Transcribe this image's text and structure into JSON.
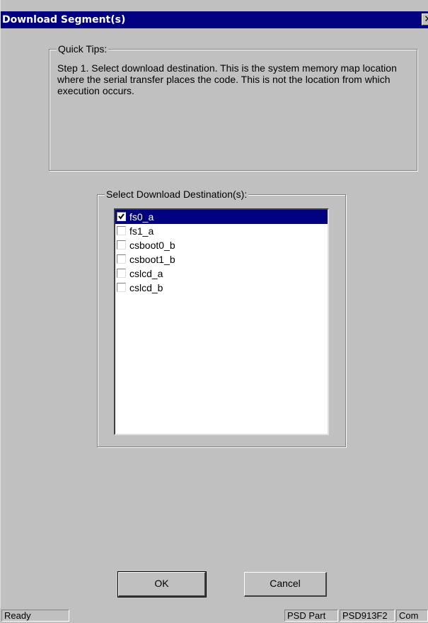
{
  "window": {
    "title": "Download Segment(s)",
    "close_glyph": "✕"
  },
  "tips": {
    "legend": "Quick Tips:",
    "text": "Step 1.  Select download destination.  This is the system memory map location where the serial transfer places the code.  This is not the location from which execution occurs."
  },
  "destinations": {
    "legend": "Select Download Destination(s):",
    "items": [
      {
        "label": "fs0_a",
        "checked": true,
        "selected": true
      },
      {
        "label": "fs1_a",
        "checked": false,
        "selected": false
      },
      {
        "label": "csboot0_b",
        "checked": false,
        "selected": false
      },
      {
        "label": "csboot1_b",
        "checked": false,
        "selected": false
      },
      {
        "label": "cslcd_a",
        "checked": false,
        "selected": false
      },
      {
        "label": "cslcd_b",
        "checked": false,
        "selected": false
      }
    ]
  },
  "buttons": {
    "ok": "OK",
    "cancel": "Cancel"
  },
  "statusbar": {
    "status": "Ready",
    "psd_part_label": "PSD Part",
    "psd_part_value": "PSD913F2",
    "third_panel": "Com"
  }
}
